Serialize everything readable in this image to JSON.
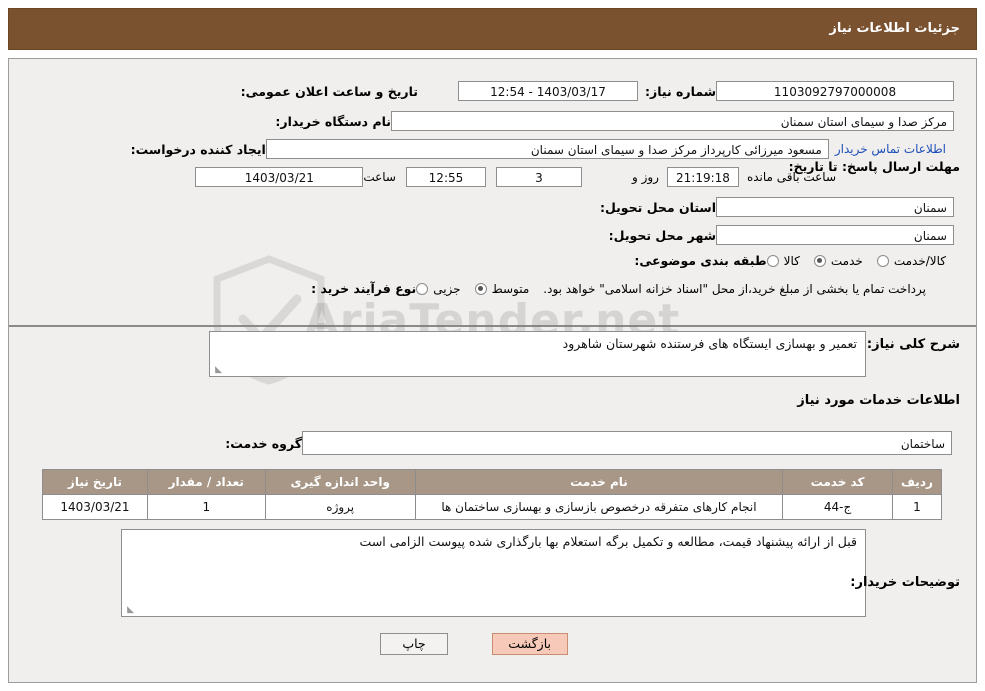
{
  "header": {
    "title": "جزئیات اطلاعات نیاز"
  },
  "form": {
    "need_number_label": "شماره نیاز:",
    "need_number_value": "1103092797000008",
    "announce_datetime_label": "تاریخ و ساعت اعلان عمومی:",
    "announce_datetime_value": "1403/03/17 - 12:54",
    "buyer_org_label": "نام دستگاه خریدار:",
    "buyer_org_value": "مرکز صدا و سیمای استان سمنان",
    "requester_label": "ایجاد کننده درخواست:",
    "requester_value": "مسعود میرزائی کارپرداز مرکز صدا و سیمای استان سمنان",
    "buyer_contact_link": "اطلاعات تماس خریدار",
    "deadline_label": "مهلت ارسال پاسخ: تا تاریخ:",
    "deadline_date": "1403/03/21",
    "deadline_hour_label": "ساعت",
    "deadline_time": "12:55",
    "remaining_days": "3",
    "remaining_days_label": "روز و",
    "remaining_clock": "21:19:18",
    "remaining_suffix": "ساعت باقی مانده",
    "delivery_province_label": "استان محل تحویل:",
    "delivery_province_value": "سمنان",
    "delivery_city_label": "شهر محل تحویل:",
    "delivery_city_value": "سمنان",
    "category_label": "طبقه بندی موضوعی:",
    "category_options": [
      {
        "label": "کالا",
        "selected": false
      },
      {
        "label": "خدمت",
        "selected": true
      },
      {
        "label": "کالا/خدمت",
        "selected": false
      }
    ],
    "purchase_type_label": "نوع فرآیند خرید :",
    "purchase_type_options": [
      {
        "label": "جزیی",
        "selected": false
      },
      {
        "label": "متوسط",
        "selected": true
      }
    ],
    "purchase_note": "پرداخت تمام یا بخشی از مبلغ خرید،از محل \"اسناد خزانه اسلامی\" خواهد بود."
  },
  "summary": {
    "label": "شرح کلی نیاز:",
    "value": "تعمیر و بهسازی ایستگاه های فرستنده شهرستان شاهرود"
  },
  "services": {
    "section_title": "اطلاعات خدمات مورد نیاز",
    "group_label": "گروه خدمت:",
    "group_value": "ساختمان",
    "columns": [
      "ردیف",
      "کد خدمت",
      "نام خدمت",
      "واحد اندازه گیری",
      "تعداد / مقدار",
      "تاریخ نیاز"
    ],
    "rows": [
      {
        "index": "1",
        "code": "ج-44",
        "name": "انجام کارهای متفرقه درخصوص بازسازی و بهسازی ساختمان ها",
        "unit": "پروژه",
        "qty": "1",
        "date": "1403/03/21"
      }
    ]
  },
  "buyer_notes": {
    "label": "توضیحات خریدار:",
    "value": "قبل از ارائه پیشنهاد قیمت، مطالعه و تکمیل برگه استعلام بها بارگذاری شده پیوست الزامی است"
  },
  "footer": {
    "print_label": "چاپ",
    "back_label": "بازگشت"
  },
  "watermark": {
    "text": "AriaTender.net"
  }
}
